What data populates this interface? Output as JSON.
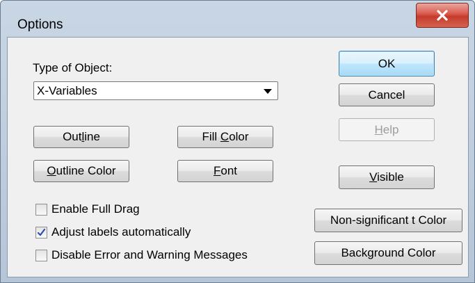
{
  "window": {
    "title": "Options",
    "close_symbol": "X"
  },
  "type_of_object": {
    "label": "Type of Object:",
    "selected": "X-Variables"
  },
  "buttons": {
    "ok": "OK",
    "cancel": "Cancel",
    "help": {
      "before": "",
      "mnemonic": "H",
      "after": "elp",
      "enabled": false
    },
    "outline": {
      "before": "Out",
      "mnemonic": "l",
      "after": "ine"
    },
    "fill_color": {
      "before": "Fill ",
      "mnemonic": "C",
      "after": "olor"
    },
    "outline_color": {
      "before": "",
      "mnemonic": "O",
      "after": "utline Color"
    },
    "font": {
      "before": "",
      "mnemonic": "F",
      "after": "ont"
    },
    "visible": {
      "before": "",
      "mnemonic": "V",
      "after": "isible"
    },
    "nonsig_color": "Non-significant t Color",
    "background_color": "Background Color"
  },
  "checkboxes": [
    {
      "label": "Enable Full Drag",
      "checked": false
    },
    {
      "label": "Adjust labels automatically",
      "checked": true
    },
    {
      "label": "Disable Error and Warning Messages",
      "checked": false
    }
  ],
  "icons": {
    "close": "close-icon",
    "dropdown": "chevron-down-icon",
    "check": "checkmark-icon"
  }
}
